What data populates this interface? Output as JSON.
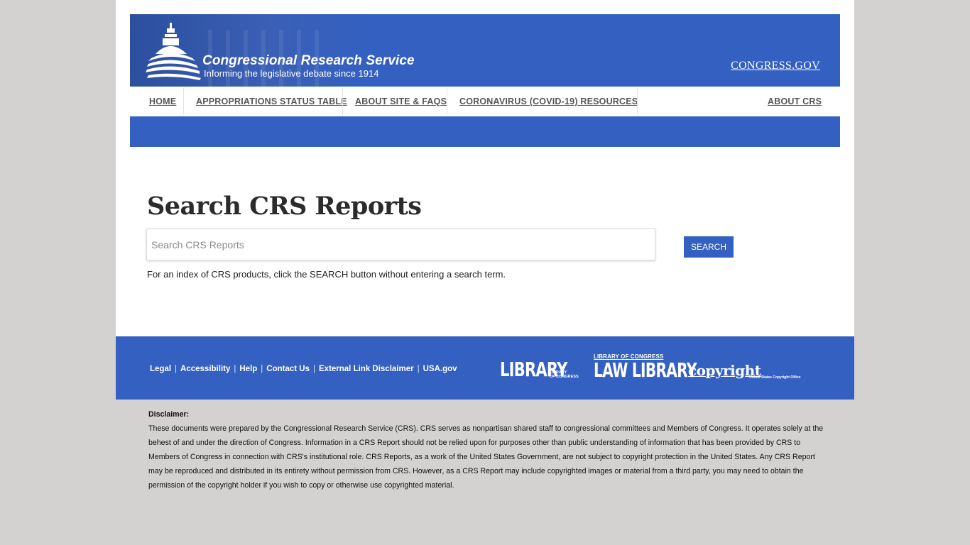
{
  "header": {
    "title": "Congressional Research Service",
    "tagline": "Informing the legislative debate since 1914",
    "congress_link": "CONGRESS.GOV",
    "brand_color": "#3460c1",
    "logo_icon": "capitol-dome-icon"
  },
  "nav": {
    "items": [
      {
        "label": "HOME"
      },
      {
        "label": "APPROPRIATIONS STATUS TABLE"
      },
      {
        "label": "ABOUT SITE & FAQS"
      },
      {
        "label": "CORONAVIRUS (COVID-19) RESOURCES"
      },
      {
        "label": "ABOUT CRS"
      }
    ]
  },
  "main": {
    "title": "Search CRS Reports",
    "search_placeholder": "Search CRS Reports",
    "search_value": "",
    "search_button": "SEARCH",
    "hint": "For an index of CRS products, click the SEARCH button without entering a search term."
  },
  "footer": {
    "links": [
      "Legal",
      "Accessibility",
      "Help",
      "Contact Us",
      "External Link Disclaimer",
      "USA.gov"
    ],
    "logos": {
      "library_big": "LIBRARY",
      "library_small_1": "LIBRARY",
      "library_small_2": "OF CONGRESS",
      "law_top": "LIBRARY OF CONGRESS",
      "law_big": "LAW LIBRARY",
      "copyright_big": "copyright",
      "copyright_small": "United States Copyright Office"
    }
  },
  "disclaimer": {
    "heading": "Disclaimer:",
    "text": "These documents were prepared by the Congressional Research Service (CRS). CRS serves as nonpartisan shared staff to congressional committees and Members of Congress. It operates solely at the behest of and under the direction of Congress. Information in a CRS Report should not be relied upon for purposes other than public understanding of information that has been provided by CRS to Members of Congress in connection with CRS's institutional role. CRS Reports, as a work of the United States Government, are not subject to copyright protection in the United States. Any CRS Report may be reproduced and distributed in its entirety without permission from CRS. However, as a CRS Report may include copyrighted images or material from a third party, you may need to obtain the permission of the copyright holder if you wish to copy or otherwise use copyrighted material."
  }
}
